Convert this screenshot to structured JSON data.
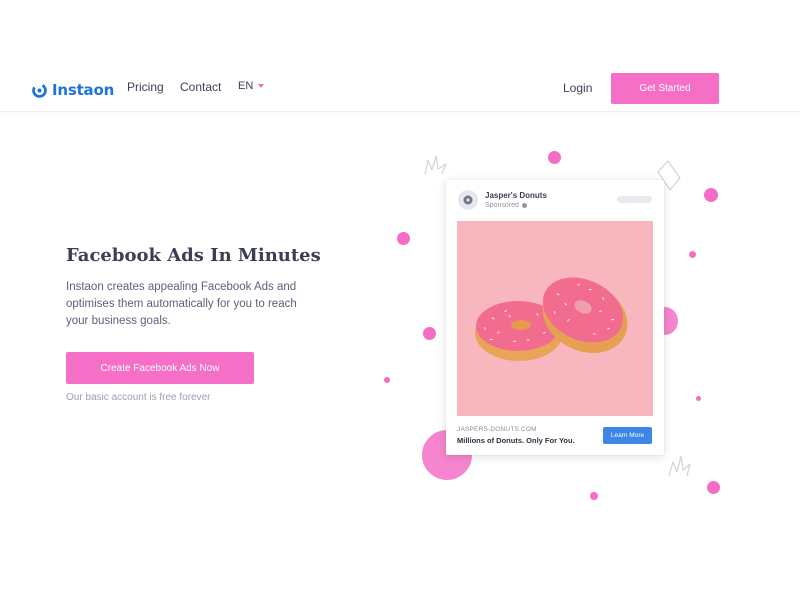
{
  "header": {
    "logo_text": "Instaon",
    "nav": {
      "pricing": "Pricing",
      "contact": "Contact",
      "language": "EN"
    },
    "login": "Login",
    "get_started": "Get Started"
  },
  "hero": {
    "title": "Facebook Ads In Minutes",
    "description": "Instaon creates appealing Facebook Ads and optimises them automatically for you to reach your business goals.",
    "cta": "Create Facebook Ads Now",
    "note": "Our basic account is free forever"
  },
  "ad": {
    "page_name": "Jasper's Donuts",
    "sponsored": "Sponsored",
    "domain": "JASPERS-DONUTS.COM",
    "headline": "Millions of Donuts. Only For You.",
    "cta": "Learn More"
  },
  "colors": {
    "brand_blue": "#1e74d9",
    "accent_pink": "#f56fc6",
    "ad_button_blue": "#3d86e8",
    "ad_image_bg": "#f8b6bf"
  },
  "icons": {
    "logo": "instaon-logo-icon",
    "language_caret": "caret-down-icon",
    "ad_avatar": "donut-avatar-icon",
    "sponsored_globe": "globe-icon"
  }
}
